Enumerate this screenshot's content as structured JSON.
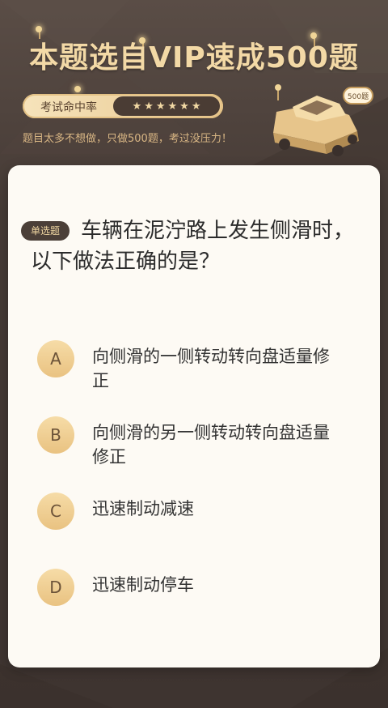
{
  "header": {
    "title": "本题选自VIP速成500题",
    "rate_label": "考试命中率",
    "star_count": 6,
    "subtitle": "题目太多不想做，只做500题，考过没压力！",
    "car_badge": "500题"
  },
  "question": {
    "type_label": "单选题",
    "text": "车辆在泥泞路上发生侧滑时，以下做法正确的是？"
  },
  "options": [
    {
      "letter": "A",
      "text": "向侧滑的一侧转动转向盘适量修正"
    },
    {
      "letter": "B",
      "text": "向侧滑的另一侧转动转向盘适量修正"
    },
    {
      "letter": "C",
      "text": "迅速制动减速"
    },
    {
      "letter": "D",
      "text": "迅速制动停车"
    }
  ],
  "colors": {
    "background": "#4a3f3a",
    "gold": "#f3d9a6",
    "card": "#fdfaf4",
    "option_circle": "#efcf93"
  }
}
